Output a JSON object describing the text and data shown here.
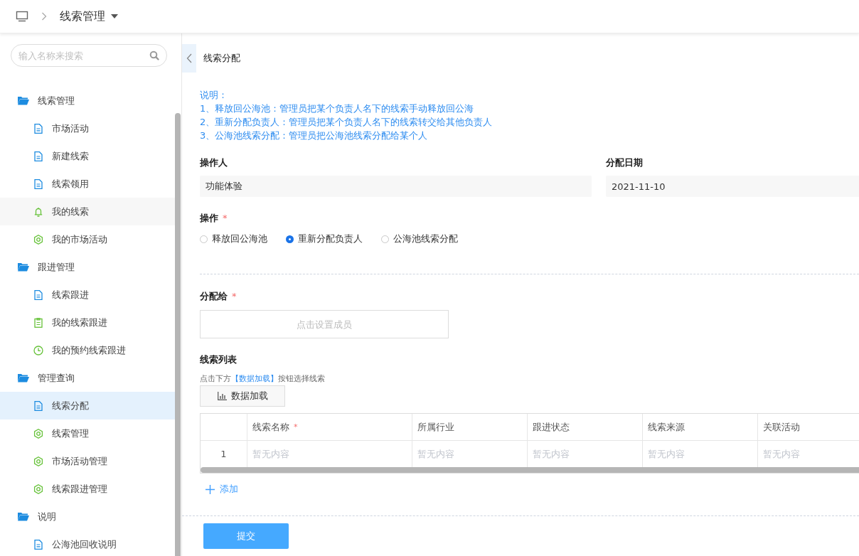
{
  "header": {
    "breadcrumb": "线索管理"
  },
  "sidebar": {
    "search": {
      "placeholder": "输入名称来搜索"
    },
    "groups": [
      {
        "label": "线索管理",
        "selected": false,
        "children": [
          {
            "label": "市场活动",
            "kind": "document",
            "selected": false
          },
          {
            "label": "新建线索",
            "kind": "document",
            "selected": false
          },
          {
            "label": "线索领用",
            "kind": "document",
            "selected": false
          },
          {
            "label": "我的线索",
            "kind": "bell",
            "selected": false,
            "hovered": true
          },
          {
            "label": "我的市场活动",
            "kind": "hexagon",
            "selected": false
          }
        ]
      },
      {
        "label": "跟进管理",
        "selected": false,
        "children": [
          {
            "label": "线索跟进",
            "kind": "document",
            "selected": false
          },
          {
            "label": "我的线索跟进",
            "kind": "clipboard",
            "selected": false
          },
          {
            "label": "我的预约线索跟进",
            "kind": "clock",
            "selected": false
          }
        ]
      },
      {
        "label": "管理查询",
        "selected": false,
        "children": [
          {
            "label": "线索分配",
            "kind": "document",
            "selected": true
          },
          {
            "label": "线索管理",
            "kind": "hexagon",
            "selected": false
          },
          {
            "label": "市场活动管理",
            "kind": "hexagon",
            "selected": false
          },
          {
            "label": "线索跟进管理",
            "kind": "hexagon",
            "selected": false
          }
        ]
      },
      {
        "label": "说明",
        "selected": false,
        "children": [
          {
            "label": "公海池回收说明",
            "kind": "document",
            "selected": false
          }
        ]
      }
    ]
  },
  "page": {
    "title": "线索分配",
    "notes": [
      "说明：",
      "1、释放回公海池：管理员把某个负责人名下的线索手动释放回公海",
      "2、重新分配负责人：管理员把某个负责人名下的线索转交给其他负责人",
      "3、公海池线索分配：管理员把公海池线索分配给某个人"
    ],
    "operator": {
      "label": "操作人",
      "value": "功能体验"
    },
    "date": {
      "label": "分配日期",
      "value": "2021-11-10"
    },
    "operation": {
      "label": "操作",
      "mark": "*",
      "options": [
        {
          "label": "释放回公海池",
          "selected": false
        },
        {
          "label": "重新分配负责人",
          "selected": true
        },
        {
          "label": "公海池线索分配",
          "selected": false
        }
      ]
    },
    "assign": {
      "label": "分配给",
      "mark": "*",
      "placeholder": "点击设置成员"
    },
    "list": {
      "title": "线索列表",
      "hint": "点击下方**【数据加载】**按钮选择线索",
      "load_button": "数据加载",
      "columns": [
        {
          "label": "线索名称",
          "mark": "*"
        },
        {
          "label": "所属行业"
        },
        {
          "label": "跟进状态"
        },
        {
          "label": "线索来源"
        },
        {
          "label": "关联活动"
        }
      ],
      "rows": [
        {
          "index": "1",
          "cells": [
            "暂无内容",
            "暂无内容",
            "暂无内容",
            "暂无内容",
            "暂无内容"
          ]
        }
      ],
      "add": "添加"
    },
    "submit": "提交"
  }
}
